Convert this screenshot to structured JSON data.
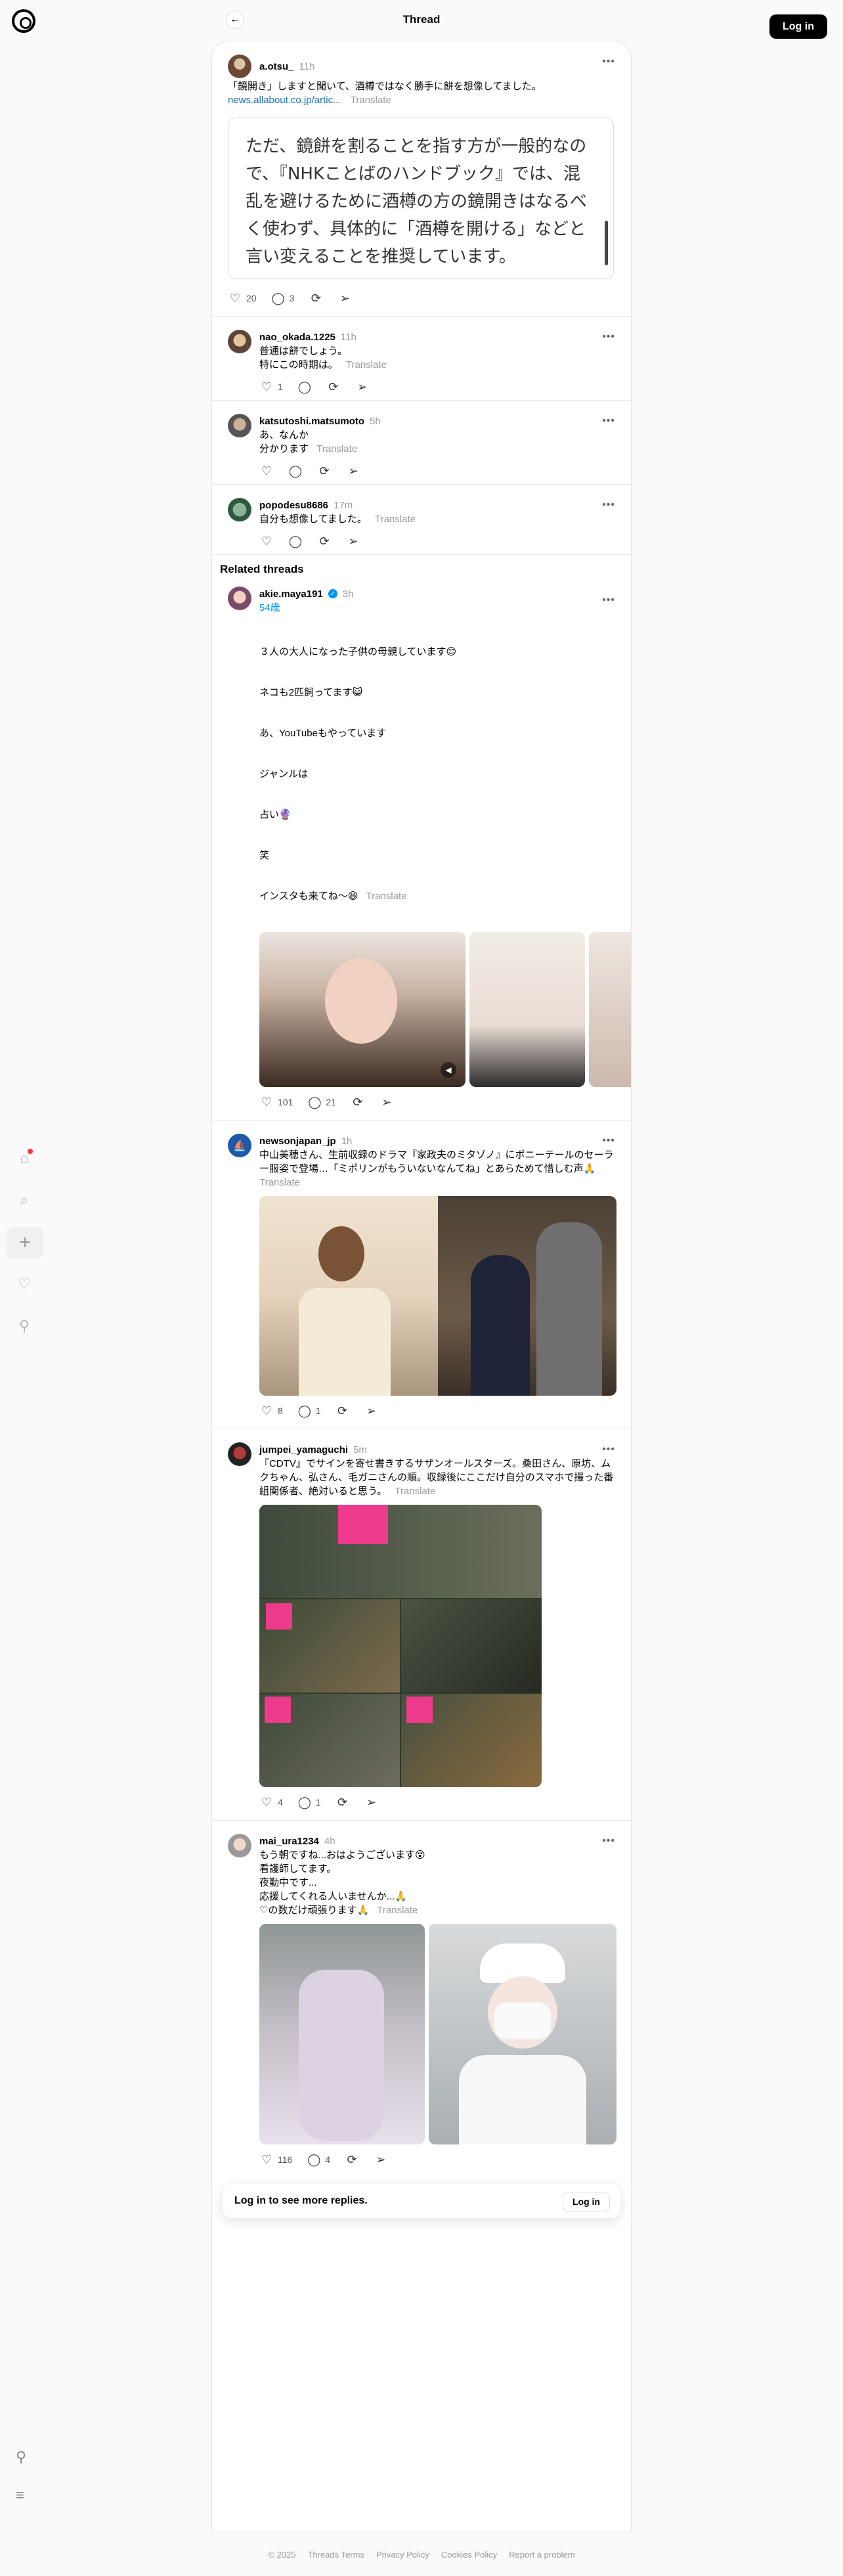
{
  "header": {
    "title": "Thread",
    "login": "Log in"
  },
  "rail": {
    "icons": [
      "home-icon",
      "search-icon",
      "create-icon",
      "heart-icon",
      "profile-icon",
      "pin-icon",
      "menu-icon"
    ]
  },
  "main_post": {
    "username": "a.otsu_",
    "time": "11h",
    "text": "「鏡開き」しますと聞いて、酒樽ではなく勝手に餅を想像してました。",
    "link": "news.allabout.co.jp/artic...",
    "translate": "Translate",
    "quote": "ただ、鏡餅を割ることを指す方が一般的なので、『NHKことばのハンドブック』では、混乱を避けるために酒樽の方の鏡開きはなるべく使わず、具体的に「酒樽を開ける」などと言い変えることを推奨しています。",
    "likes": "20",
    "replies": "3"
  },
  "replies": [
    {
      "username": "nao_okada.1225",
      "time": "11h",
      "text": "普通は餅でしょう。\n特にこの時期は。",
      "translate": "Translate",
      "likes": "1",
      "replies": ""
    },
    {
      "username": "katsutoshi.matsumoto",
      "time": "5h",
      "text": "あ、なんか\n分かります",
      "translate": "Translate",
      "likes": "",
      "replies": ""
    },
    {
      "username": "popodesu8686",
      "time": "17m",
      "text": "自分も想像してました。",
      "translate": "Translate",
      "likes": "",
      "replies": ""
    }
  ],
  "related_title": "Related threads",
  "related": [
    {
      "username": "akie.maya191",
      "time": "3h",
      "sub": "54歳",
      "lines": [
        "３人の大人になった子供の母親しています😊",
        "ネコも2匹飼ってます😺",
        "あ、YouTubeもやっています",
        "ジャンルは",
        "占い🔮",
        "笑",
        "インスタも来てね〜😆"
      ],
      "translate": "Translate",
      "likes": "101",
      "replies": "21"
    },
    {
      "username": "newsonjapan_jp",
      "time": "1h",
      "text": "中山美穂さん、生前収録のドラマ『家政夫のミタゾノ』にポニーテールのセーラー服姿で登場…「ミポリンがもういないなんてね」とあらためて惜しむ声🙏",
      "translate": "Translate",
      "likes": "8",
      "replies": "1"
    },
    {
      "username": "jumpei_yamaguchi",
      "time": "5m",
      "text": "『CDTV』でサインを寄せ書きするサザンオールスターズ。桑田さん、原坊、ムクちゃん、弘さん、毛ガニさんの順。収録後にここだけ自分のスマホで撮った番組関係者、絶対いると思う。",
      "translate": "Translate",
      "likes": "4",
      "replies": "1"
    },
    {
      "username": "mai_ura1234",
      "time": "4h",
      "text": "もう朝ですね...おはようございます😵\n看護師してます。\n夜勤中です...\n応援してくれる人いませんか...🙏\n♡の数だけ頑張ります🙏",
      "translate": "Translate",
      "likes": "116",
      "replies": "4"
    }
  ],
  "login_card": {
    "text": "Log in to see more replies.",
    "button": "Log in"
  },
  "footer": [
    "© 2025",
    "Threads Terms",
    "Privacy Policy",
    "Cookies Policy",
    "Report a problem"
  ]
}
